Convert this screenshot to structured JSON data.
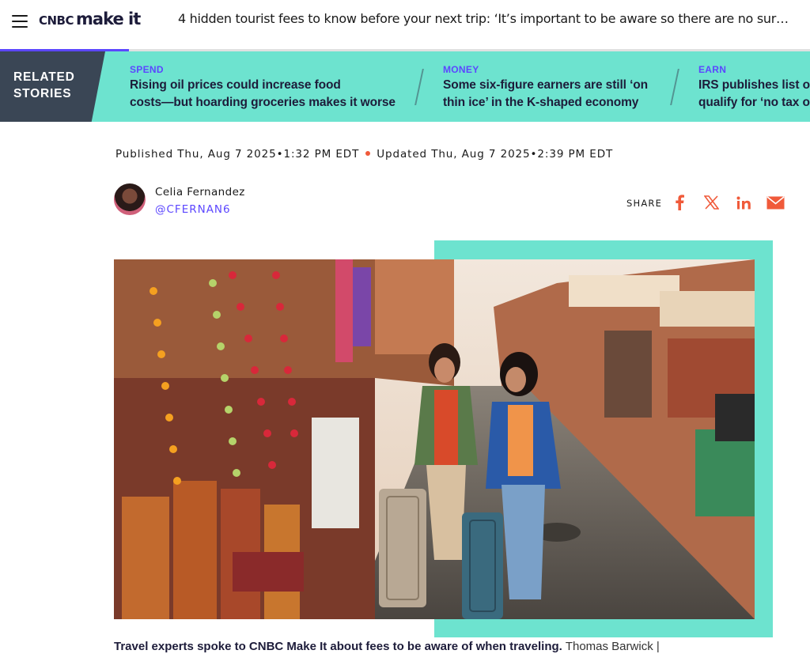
{
  "header": {
    "brand_cnbc": "CNBC",
    "brand_makeit": "make it",
    "headline": "4 hidden tourist fees to know before your next trip: ‘It’s important to be aware so there are no sur…"
  },
  "related": {
    "label_line1": "RELATED",
    "label_line2": "STORIES",
    "stories": [
      {
        "category": "SPEND",
        "title_line1": "Rising oil prices could increase food",
        "title_line2": "costs—but hoarding groceries makes it worse"
      },
      {
        "category": "MONEY",
        "title_line1": "Some six-figure earners are still ‘on",
        "title_line2": "thin ice’ in the K-shaped economy"
      },
      {
        "category": "EARN",
        "title_line1": "IRS publishes list of",
        "title_line2": "qualify for ‘no tax o"
      }
    ]
  },
  "meta": {
    "published": "Published Thu, Aug 7 2025•1:32 PM EDT",
    "updated": "Updated Thu, Aug 7 2025•2:39 PM EDT"
  },
  "author": {
    "name": "Celia Fernandez",
    "handle": "@CFERNAN6"
  },
  "share": {
    "label": "SHARE",
    "icons": [
      "facebook-icon",
      "x-icon",
      "linkedin-icon",
      "email-icon"
    ],
    "color": "#f05a3a"
  },
  "caption": {
    "main": "Travel experts spoke to CNBC Make It about fees to be aware of when traveling.",
    "credit": "Thomas Barwick |"
  },
  "colors": {
    "accent": "#5c47ff",
    "teal": "#6de3cf",
    "navy": "#1d1c3a",
    "slate": "#3a4655"
  }
}
